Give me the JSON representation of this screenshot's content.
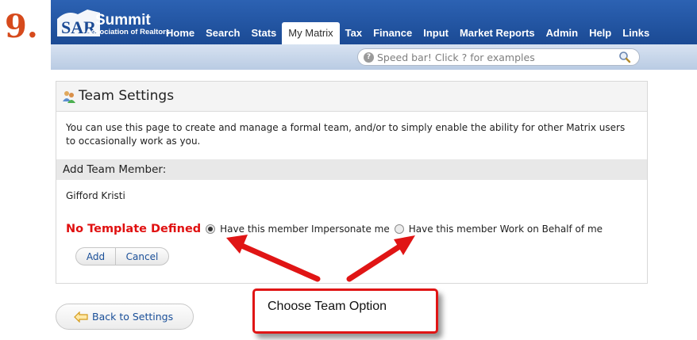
{
  "step": {
    "number": "9."
  },
  "logo": {
    "name": "Summit",
    "subtitle": "Association of Realtors"
  },
  "nav": {
    "items": [
      {
        "label": "Home",
        "active": false
      },
      {
        "label": "Search",
        "active": false
      },
      {
        "label": "Stats",
        "active": false
      },
      {
        "label": "My Matrix",
        "active": true
      },
      {
        "label": "Tax",
        "active": false
      },
      {
        "label": "Finance",
        "active": false
      },
      {
        "label": "Input",
        "active": false
      },
      {
        "label": "Market Reports",
        "active": false
      },
      {
        "label": "Admin",
        "active": false
      },
      {
        "label": "Help",
        "active": false
      },
      {
        "label": "Links",
        "active": false
      }
    ]
  },
  "speedbar": {
    "placeholder": "Speed bar! Click ? for examples"
  },
  "panel": {
    "title": "Team Settings",
    "description": "You can use this page to create and manage a formal team, and/or to simply enable the ability for other Matrix users to occasionally work as you.",
    "section_title": "Add Team Member:",
    "member_name": "Gifford Kristi",
    "no_template": "No Template Defined",
    "option_impersonate": "Have this member Impersonate me",
    "option_behalf": "Have this member Work on Behalf of me",
    "add_label": "Add",
    "cancel_label": "Cancel"
  },
  "back": {
    "label": "Back to Settings"
  },
  "callout": {
    "text": "Choose Team Option"
  },
  "colors": {
    "nav_blue": "#1b4a94",
    "step_orange": "#d64a1c",
    "warning_red": "#e01010",
    "link_blue": "#1a4f99",
    "annotation_red": "#e01515"
  }
}
